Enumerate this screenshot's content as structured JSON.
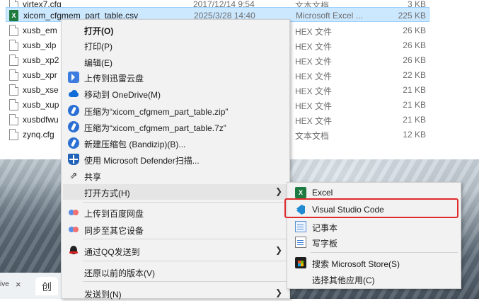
{
  "files": [
    {
      "name": "virtex7.cfg",
      "date": "2017/12/14 9:54",
      "type": "文本文档",
      "size": "3 KB",
      "icon": "doc"
    },
    {
      "name": "xicom_cfgmem_part_table.csv",
      "date": "2025/3/28 14:40",
      "type": "Microsoft Excel ...",
      "size": "225 KB",
      "icon": "excel",
      "selected": true
    },
    {
      "name": "xusb_em",
      "date": "",
      "type": "HEX 文件",
      "size": "26 KB",
      "icon": "doc"
    },
    {
      "name": "xusb_xlp",
      "date": "",
      "type": "HEX 文件",
      "size": "26 KB",
      "icon": "doc"
    },
    {
      "name": "xusb_xp2",
      "date": "",
      "type": "HEX 文件",
      "size": "26 KB",
      "icon": "doc"
    },
    {
      "name": "xusb_xpr",
      "date": "",
      "type": "HEX 文件",
      "size": "22 KB",
      "icon": "doc"
    },
    {
      "name": "xusb_xse",
      "date": "",
      "type": "HEX 文件",
      "size": "21 KB",
      "icon": "doc"
    },
    {
      "name": "xusb_xup",
      "date": "",
      "type": "HEX 文件",
      "size": "21 KB",
      "icon": "doc"
    },
    {
      "name": "xusbdfwu",
      "date": "",
      "type": "HEX 文件",
      "size": "21 KB",
      "icon": "doc"
    },
    {
      "name": "zynq.cfg",
      "date": "",
      "type": "文本文档",
      "size": "12 KB",
      "icon": "doc"
    }
  ],
  "context_menu": {
    "open": "打开(O)",
    "print": "打印(P)",
    "edit": "编辑(E)",
    "upload_thunder": "上传到迅雷云盘",
    "move_onedrive": "移动到 OneDrive(M)",
    "compress_zip": "压缩为“xicom_cfgmem_part_table.zip”",
    "compress_7z": "压缩为“xicom_cfgmem_part_table.7z”",
    "new_archive": "新建压缩包 (Bandizip)(B)...",
    "defender": "使用 Microsoft Defender扫描...",
    "share": "共享",
    "open_with": "打开方式(H)",
    "upload_baidu": "上传到百度网盘",
    "sync_devices": "同步至其它设备",
    "send_qq": "通过QQ发送到",
    "restore_version": "还原以前的版本(V)",
    "send_to": "发送到(N)"
  },
  "open_with_menu": {
    "excel": "Excel",
    "vscode": "Visual Studio Code",
    "notepad": "记事本",
    "wordpad": "写字板",
    "search_store": "搜索 Microsoft Store(S)",
    "choose_other": "选择其他应用(C)"
  },
  "taskbar": {
    "tab_text": "创",
    "close_glyph": "×",
    "vert_text": "ive"
  },
  "colors": {
    "selection": "#cce8ff",
    "menu_bg": "#f2f2f2",
    "highlight_box": "#e02b2b",
    "excel_green": "#1d7a40",
    "vscode_blue": "#1f8ad2"
  }
}
